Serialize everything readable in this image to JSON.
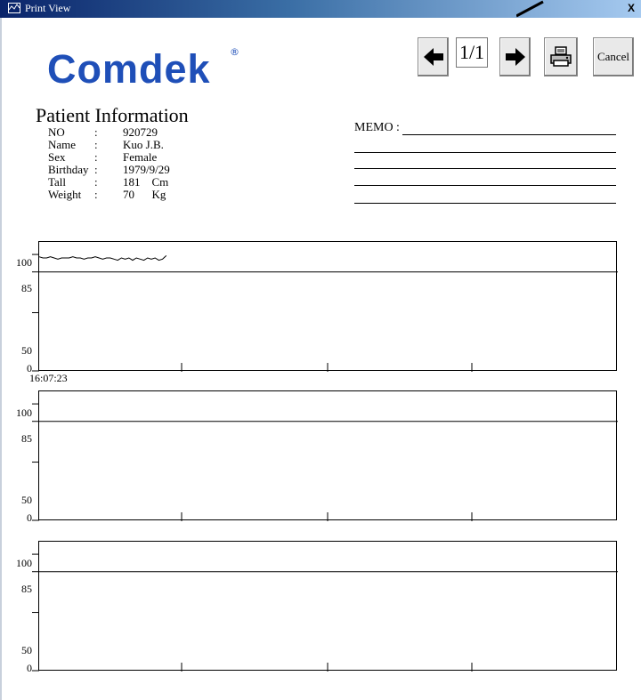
{
  "window": {
    "title": "Print View",
    "close_glyph": "X"
  },
  "toolbar": {
    "page_indicator": "1/1",
    "cancel_label": "Cancel",
    "prev_icon": "arrow-left-icon",
    "next_icon": "arrow-right-icon",
    "print_icon": "printer-icon"
  },
  "logo": {
    "text": "Comdek",
    "mark": "®"
  },
  "patient": {
    "heading": "Patient Information",
    "fields": [
      {
        "label": "NO",
        "colon": ":",
        "value": "920729"
      },
      {
        "label": "Name",
        "colon": ":",
        "value": "Kuo J.B."
      },
      {
        "label": "Sex",
        "colon": ":",
        "value": "Female"
      },
      {
        "label": "Birthday",
        "colon": ":",
        "value": "1979/9/29"
      },
      {
        "label": "Tall",
        "colon": ":",
        "value": "181    Cm"
      },
      {
        "label": "Weight",
        "colon": ":",
        "value": "70      Kg"
      }
    ]
  },
  "memo": {
    "label": "MEMO :"
  },
  "charts": [
    {
      "y_labels": [
        "100",
        "85",
        "50",
        "0"
      ],
      "time_label": "16:07:23"
    },
    {
      "y_labels": [
        "100",
        "85",
        "50",
        "0"
      ]
    },
    {
      "y_labels": [
        "100",
        "85",
        "50",
        "0"
      ]
    }
  ],
  "chart_data": {
    "type": "line",
    "ylim": [
      0,
      110
    ],
    "reference_line": 85,
    "y_ticks": [
      100,
      85,
      50,
      0
    ],
    "series": [
      {
        "values": [
          98,
          97,
          97,
          98,
          97,
          96,
          97,
          97,
          97,
          98,
          97,
          97,
          96,
          97,
          97,
          98,
          97,
          96,
          97,
          97,
          96,
          95,
          97,
          96,
          97,
          95,
          97,
          96,
          95,
          97,
          96,
          97,
          95,
          96,
          99
        ]
      }
    ]
  }
}
